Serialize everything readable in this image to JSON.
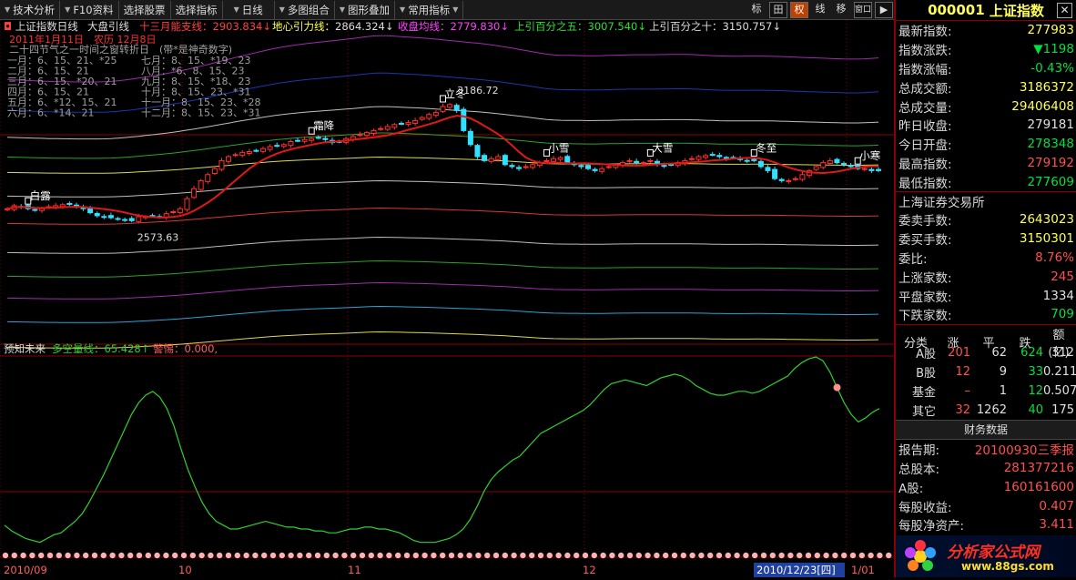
{
  "toolbar": {
    "items": [
      "技术分析",
      "F10资料",
      "选择股票",
      "选择指标",
      "日线",
      "多图组合",
      "图形叠加",
      "常用指标"
    ],
    "right_buttons": [
      "标",
      "田",
      "权",
      "线",
      "移",
      "窗口",
      "▶"
    ]
  },
  "main_chart": {
    "header": {
      "name": "上证指数日线",
      "indicator": "大盘引线",
      "l1_label": "十三月能支线：",
      "l1_value": "2903.834↓",
      "l2_label": "地心引力线：",
      "l2_value": "2864.324↓",
      "l3_label": "收盘均线：",
      "l3_value": "2779.830↓",
      "l4_label": "上引百分之五：",
      "l4_value": "3007.540↓",
      "l5_label": "上引百分之十：",
      "l5_value": "3150.757↓"
    },
    "legend_title": "2011年1月11日　农历 12月8日",
    "legend_sub": "二十四节气之一时间之窗转折日　(带*是神奇数字)",
    "legend_rows": [
      [
        "一月：6、15、21、*25",
        "七月：8、15、*19、23"
      ],
      [
        "二月：6、15、21",
        "八月：*6、8、15、23"
      ],
      [
        "三月：6、15、*20、21",
        "九月：8、15、*18、23"
      ],
      [
        "四月：6、15、21",
        "十月：8、15、23、*31"
      ],
      [
        "五月：6、*12、15、21",
        "十一月：8、15、23、*28"
      ],
      [
        "六月：6、*14、21",
        "十二月：8、15、23、*31"
      ]
    ],
    "peak_label": "3186.72",
    "low_label": "2573.63",
    "term_labels": [
      {
        "t": "白露",
        "i": 3
      },
      {
        "t": "霜降",
        "i": 44
      },
      {
        "t": "立冬",
        "i": 63
      },
      {
        "t": "小雪",
        "i": 78
      },
      {
        "t": "大雪",
        "i": 93
      },
      {
        "t": "冬至",
        "i": 108
      },
      {
        "t": "小寒",
        "i": 123
      }
    ],
    "closes": [
      2640,
      2655,
      2650,
      2640,
      2635,
      2640,
      2650,
      2655,
      2660,
      2662,
      2650,
      2640,
      2620,
      2605,
      2600,
      2595,
      2590,
      2585,
      2580,
      2600,
      2600,
      2605,
      2600,
      2615,
      2625,
      2640,
      2690,
      2740,
      2780,
      2810,
      2840,
      2880,
      2900,
      2910,
      2920,
      2925,
      2930,
      2940,
      2950,
      2955,
      2960,
      2975,
      2980,
      2985,
      2990,
      2995,
      2985,
      2970,
      2975,
      2990,
      3000,
      3010,
      3020,
      3030,
      3040,
      3050,
      3060,
      3065,
      3070,
      3080,
      3095,
      3110,
      3120,
      3150,
      3160,
      3130,
      3030,
      2960,
      2900,
      2880,
      2890,
      2900,
      2860,
      2850,
      2840,
      2850,
      2860,
      2870,
      2880,
      2890,
      2895,
      2870,
      2860,
      2850,
      2840,
      2830,
      2840,
      2850,
      2860,
      2870,
      2880,
      2870,
      2870,
      2880,
      2860,
      2855,
      2860,
      2870,
      2880,
      2890,
      2900,
      2905,
      2910,
      2900,
      2890,
      2895,
      2885,
      2880,
      2880,
      2850,
      2830,
      2790,
      2780,
      2780,
      2790,
      2810,
      2830,
      2850,
      2870,
      2880,
      2870,
      2860,
      2850,
      2840,
      2840,
      2830,
      2830
    ]
  },
  "sub_chart": {
    "title": "预知未来",
    "l1": "多空量线：65.428↑",
    "l2": "警惕：0.000,",
    "values": [
      12,
      9,
      7,
      5,
      4,
      3,
      5,
      7,
      8,
      11,
      14,
      18,
      24,
      31,
      38,
      46,
      54,
      62,
      70,
      76,
      80,
      82,
      79,
      73,
      64,
      52,
      41,
      32,
      24,
      18,
      14,
      12,
      10,
      10,
      11,
      12,
      13,
      14,
      13,
      12,
      11,
      11,
      10,
      10,
      9,
      9,
      8,
      8,
      9,
      10,
      10,
      11,
      11,
      10,
      10,
      9,
      8,
      6,
      4,
      3,
      3,
      3,
      4,
      5,
      7,
      10,
      15,
      22,
      30,
      36,
      40,
      43,
      46,
      48,
      52,
      56,
      60,
      62,
      64,
      66,
      68,
      70,
      72,
      75,
      79,
      83,
      86,
      87,
      88,
      87,
      86,
      85,
      87,
      89,
      90,
      91,
      90,
      88,
      85,
      83,
      81,
      80,
      80,
      81,
      82,
      82,
      81,
      82,
      84,
      86,
      88,
      90,
      94,
      97,
      99,
      100,
      98,
      92,
      84,
      76,
      70,
      66,
      68,
      71,
      73
    ],
    "alert_dot_index": 118
  },
  "xaxis": {
    "labels": [
      "2010/09",
      "10",
      "11",
      "12",
      "1/01"
    ],
    "cursor_label": "2010/12/23[四]"
  },
  "panel": {
    "code": "000001",
    "name": "上证指数",
    "close_btn": "✕",
    "rows1": [
      {
        "k": "最新指数:",
        "v": "277983",
        "c": "yel"
      },
      {
        "k": "指数涨跌:",
        "v": "▼1198",
        "c": "grn"
      },
      {
        "k": "指数涨幅:",
        "v": "-0.43%",
        "c": "grn"
      },
      {
        "k": "总成交额:",
        "v": "3186372",
        "c": "yel"
      },
      {
        "k": "总成交量:",
        "v": "29406408",
        "c": "yel"
      },
      {
        "k": "昨日收盘:",
        "v": "279181",
        "c": "wht"
      },
      {
        "k": "今日开盘:",
        "v": "278348",
        "c": "grn"
      },
      {
        "k": "最高指数:",
        "v": "279192",
        "c": "red"
      },
      {
        "k": "最低指数:",
        "v": "277609",
        "c": "grn"
      }
    ],
    "exchange": "上海证券交易所",
    "rows2": [
      {
        "k": "委卖手数:",
        "v": "2643023",
        "c": "yel"
      },
      {
        "k": "委买手数:",
        "v": "3150301",
        "c": "yel"
      },
      {
        "k": "委比:",
        "v": "8.76%",
        "c": "red"
      },
      {
        "k": "上涨家数:",
        "v": "245",
        "c": "red"
      },
      {
        "k": "平盘家数:",
        "v": "1334",
        "c": "wht"
      },
      {
        "k": "下跌家数:",
        "v": "709",
        "c": "grn"
      }
    ],
    "table_head": [
      "分类",
      "涨",
      "平",
      "跌",
      "额(亿)"
    ],
    "table": [
      [
        "A股",
        "201",
        "62",
        "624",
        "312"
      ],
      [
        "B股",
        "12",
        "9",
        "33",
        "0.211"
      ],
      [
        "基金",
        "–",
        "1",
        "12",
        "0.507"
      ],
      [
        "其它",
        "32",
        "1262",
        "40",
        "175"
      ]
    ],
    "fin_title": "财务数据",
    "rows3": [
      {
        "k": "报告期:",
        "v": "20100930三季报",
        "c": "red"
      },
      {
        "k": "总股本:",
        "v": "281377216",
        "c": "red"
      },
      {
        "k": "A股:",
        "v": "160161600",
        "c": "red"
      },
      {
        "k": "每股收益:",
        "v": "0.407",
        "c": "red"
      },
      {
        "k": "每股净资产:",
        "v": "3.411",
        "c": "red"
      }
    ],
    "logo_text": "分析家公式网",
    "logo_url": "www.88gs.com"
  },
  "colors": {
    "up": "#ff3030",
    "down": "#30e0ff",
    "ma": "#e01818",
    "sub": "#30d030"
  }
}
